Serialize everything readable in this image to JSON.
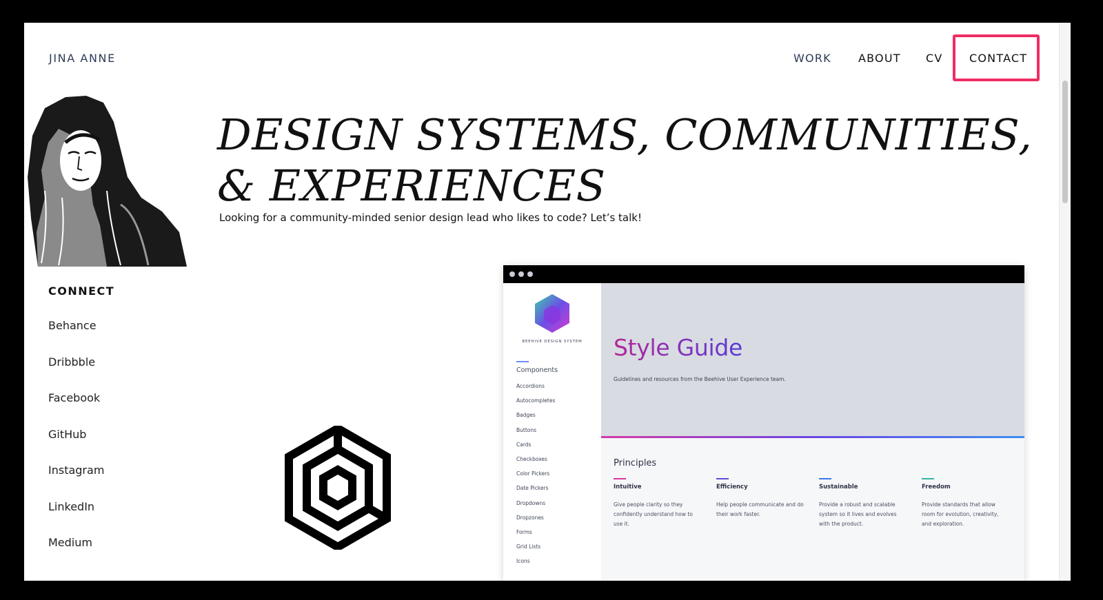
{
  "header": {
    "brand": "JINA ANNE",
    "nav": [
      "WORK",
      "ABOUT",
      "CV",
      "CONTACT"
    ]
  },
  "hero": {
    "title_line1": "DESIGN SYSTEMS, COMMUNITIES,",
    "title_line2": "& EXPERIENCES",
    "subtitle": "Looking for a community-minded senior design lead who likes to code? Let’s talk!"
  },
  "connect": {
    "title": "CONNECT",
    "links": [
      "Behance",
      "Dribbble",
      "Facebook",
      "GitHub",
      "Instagram",
      "LinkedIn",
      "Medium"
    ]
  },
  "mockup": {
    "brand": "BEEHIVE DESIGN SYSTEM",
    "sidebar_heading": "Components",
    "sidebar_items": [
      "Accordions",
      "Autocompletes",
      "Badges",
      "Buttons",
      "Cards",
      "Checkboxes",
      "Color Pickers",
      "Date Pickers",
      "Dropdowns",
      "Dropzones",
      "Forms",
      "Grid Lists",
      "Icons"
    ],
    "hero_title": "Style Guide",
    "hero_subtitle": "Guidelines and resources from the Beehive User Experience team.",
    "principles_title": "Principles",
    "principles": [
      {
        "name": "Intuitive",
        "desc": "Give people clarity so they confidently understand how to use it.",
        "color": "#d6379c"
      },
      {
        "name": "Efficiency",
        "desc": "Help people communicate and do their work faster.",
        "color": "#5a4ed6"
      },
      {
        "name": "Sustainable",
        "desc": "Provide a robust and scalable system so it lives and evolves with the product.",
        "color": "#3b78e8"
      },
      {
        "name": "Freedom",
        "desc": "Provide standards that allow room for evolution, creativity, and exploration.",
        "color": "#2fb79a"
      }
    ]
  },
  "colors": {
    "highlight": "#ef2d63",
    "nav_text": "#2e3a55"
  }
}
